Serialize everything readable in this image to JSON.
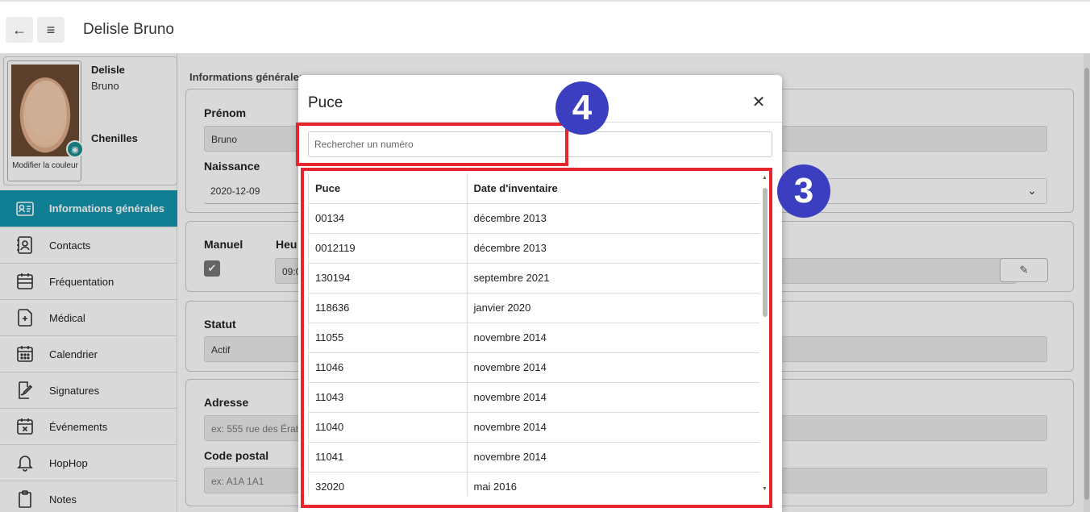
{
  "header": {
    "title": "Delisle Bruno"
  },
  "profile": {
    "last_name": "Delisle",
    "first_name": "Bruno",
    "group": "Chenilles",
    "photo_caption": "Modifier la couleur"
  },
  "sidebar": {
    "items": [
      {
        "label": "Informations générales",
        "icon": "id-card-icon",
        "active": true
      },
      {
        "label": "Contacts",
        "icon": "contacts-book-icon"
      },
      {
        "label": "Fréquentation",
        "icon": "attendance-icon"
      },
      {
        "label": "Médical",
        "icon": "medical-file-icon"
      },
      {
        "label": "Calendrier",
        "icon": "calendar-icon"
      },
      {
        "label": "Signatures",
        "icon": "signature-icon"
      },
      {
        "label": "Événements",
        "icon": "event-calendar-icon"
      },
      {
        "label": "HopHop",
        "icon": "bell-icon"
      },
      {
        "label": "Notes",
        "icon": "clipboard-icon"
      }
    ]
  },
  "main": {
    "section_title": "Informations générales",
    "prenom_label": "Prénom",
    "prenom_value": "Bruno",
    "naissance_label": "Naissance",
    "naissance_value": "2020-12-09",
    "manuel_label": "Manuel",
    "heure_label": "Heu",
    "heure_value": "09:0",
    "statut_label": "Statut",
    "statut_value": "Actif",
    "adresse_label": "Adresse",
    "adresse_placeholder": "ex: 555 rue des Érabl",
    "code_postal_label": "Code postal",
    "code_postal_placeholder": "ex: A1A 1A1"
  },
  "modal": {
    "title": "Puce",
    "search_placeholder": "Rechercher un numéro",
    "columns": [
      "Puce",
      "Date d'inventaire"
    ],
    "rows": [
      [
        "00134",
        "décembre 2013"
      ],
      [
        "0012119",
        "décembre 2013"
      ],
      [
        "130194",
        "septembre 2021"
      ],
      [
        "118636",
        "janvier 2020"
      ],
      [
        "11055",
        "novembre 2014"
      ],
      [
        "11046",
        "novembre 2014"
      ],
      [
        "11043",
        "novembre 2014"
      ],
      [
        "11040",
        "novembre 2014"
      ],
      [
        "11041",
        "novembre 2014"
      ],
      [
        "32020",
        "mai 2016"
      ]
    ]
  },
  "annotations": {
    "badge_search": "4",
    "badge_table": "3"
  },
  "colors": {
    "accent": "#1596ad",
    "highlight": "#e5262c",
    "badge": "#3b3fbf"
  }
}
